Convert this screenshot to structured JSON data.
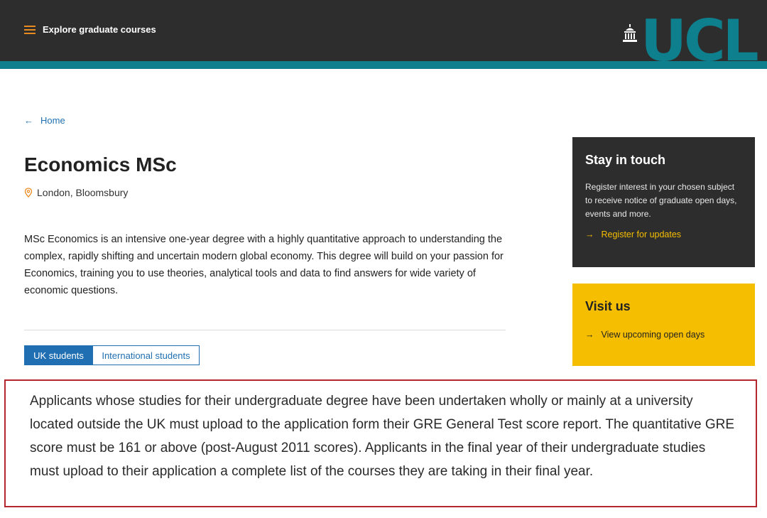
{
  "header": {
    "menu_label": "Explore graduate courses",
    "logo_text": "UCL",
    "colors": {
      "bar": "#2d2d2d",
      "accent": "#0d7f8d",
      "hamburger": "#e98c1f"
    }
  },
  "breadcrumb": {
    "label": "Home",
    "icon": "arrow-left-icon"
  },
  "course": {
    "title": "Economics MSc",
    "location": "London, Bloomsbury",
    "intro": "MSc Economics is an intensive one-year degree with a highly quantitative approach to understanding the complex, rapidly shifting and uncertain modern global economy. This degree will build on your passion for Economics, training you to use theories, analytical tools and data to find answers for wide variety of economic questions."
  },
  "tabs": [
    {
      "label": "UK students",
      "active": true
    },
    {
      "label": "International students",
      "active": false
    }
  ],
  "sidebar": {
    "stay_in_touch": {
      "title": "Stay in touch",
      "text": "Register interest in your chosen subject to receive notice of graduate open days, events and more.",
      "link": "Register for updates"
    },
    "visit_us": {
      "title": "Visit us",
      "link": "View upcoming open days"
    },
    "colors": {
      "dark": "#2d2d2d",
      "yellow": "#f6be00"
    }
  },
  "notice": {
    "text": "Applicants whose studies for their undergraduate degree have been undertaken wholly or mainly at a university located outside the UK must upload to the application form their GRE General Test score report. The quantitative GRE score must be 161 or above (post-August 2011 scores). Applicants in the final year of their undergraduate studies must upload to their application a complete list of the courses they are taking in their final year.",
    "border_color": "#b5272d"
  }
}
